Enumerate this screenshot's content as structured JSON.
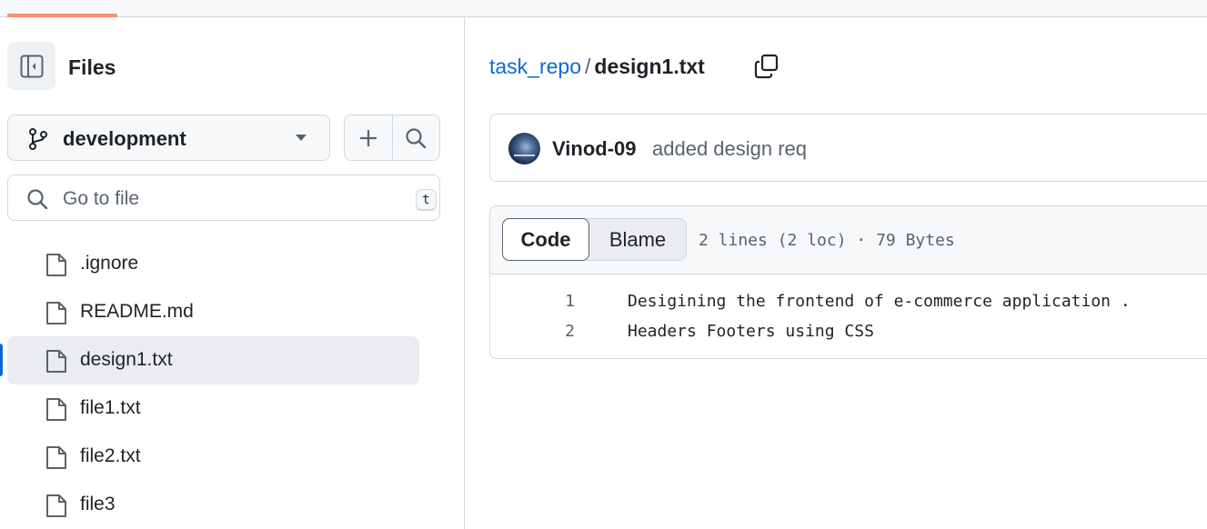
{
  "sidebar": {
    "title": "Files",
    "branch": "development",
    "search_placeholder": "Go to file",
    "search_shortcut": "t",
    "items": [
      {
        "name": ".ignore"
      },
      {
        "name": "README.md"
      },
      {
        "name": "design1.txt",
        "active": true
      },
      {
        "name": "file1.txt"
      },
      {
        "name": "file2.txt"
      },
      {
        "name": "file3"
      }
    ]
  },
  "breadcrumb": {
    "repo": "task_repo",
    "separator": "/",
    "file": "design1.txt"
  },
  "commit": {
    "author": "Vinod-09",
    "message": "added design req"
  },
  "file_view": {
    "tab_code": "Code",
    "tab_blame": "Blame",
    "stats": "2 lines (2 loc) · 79 Bytes",
    "lines": [
      {
        "num": "1",
        "text": "Desigining the frontend of e-commerce application ."
      },
      {
        "num": "2",
        "text": "Headers Footers using CSS"
      }
    ]
  },
  "colors": {
    "link": "#0969da",
    "accent_underline": "#fd8c73",
    "active_bg": "#eaecef"
  }
}
